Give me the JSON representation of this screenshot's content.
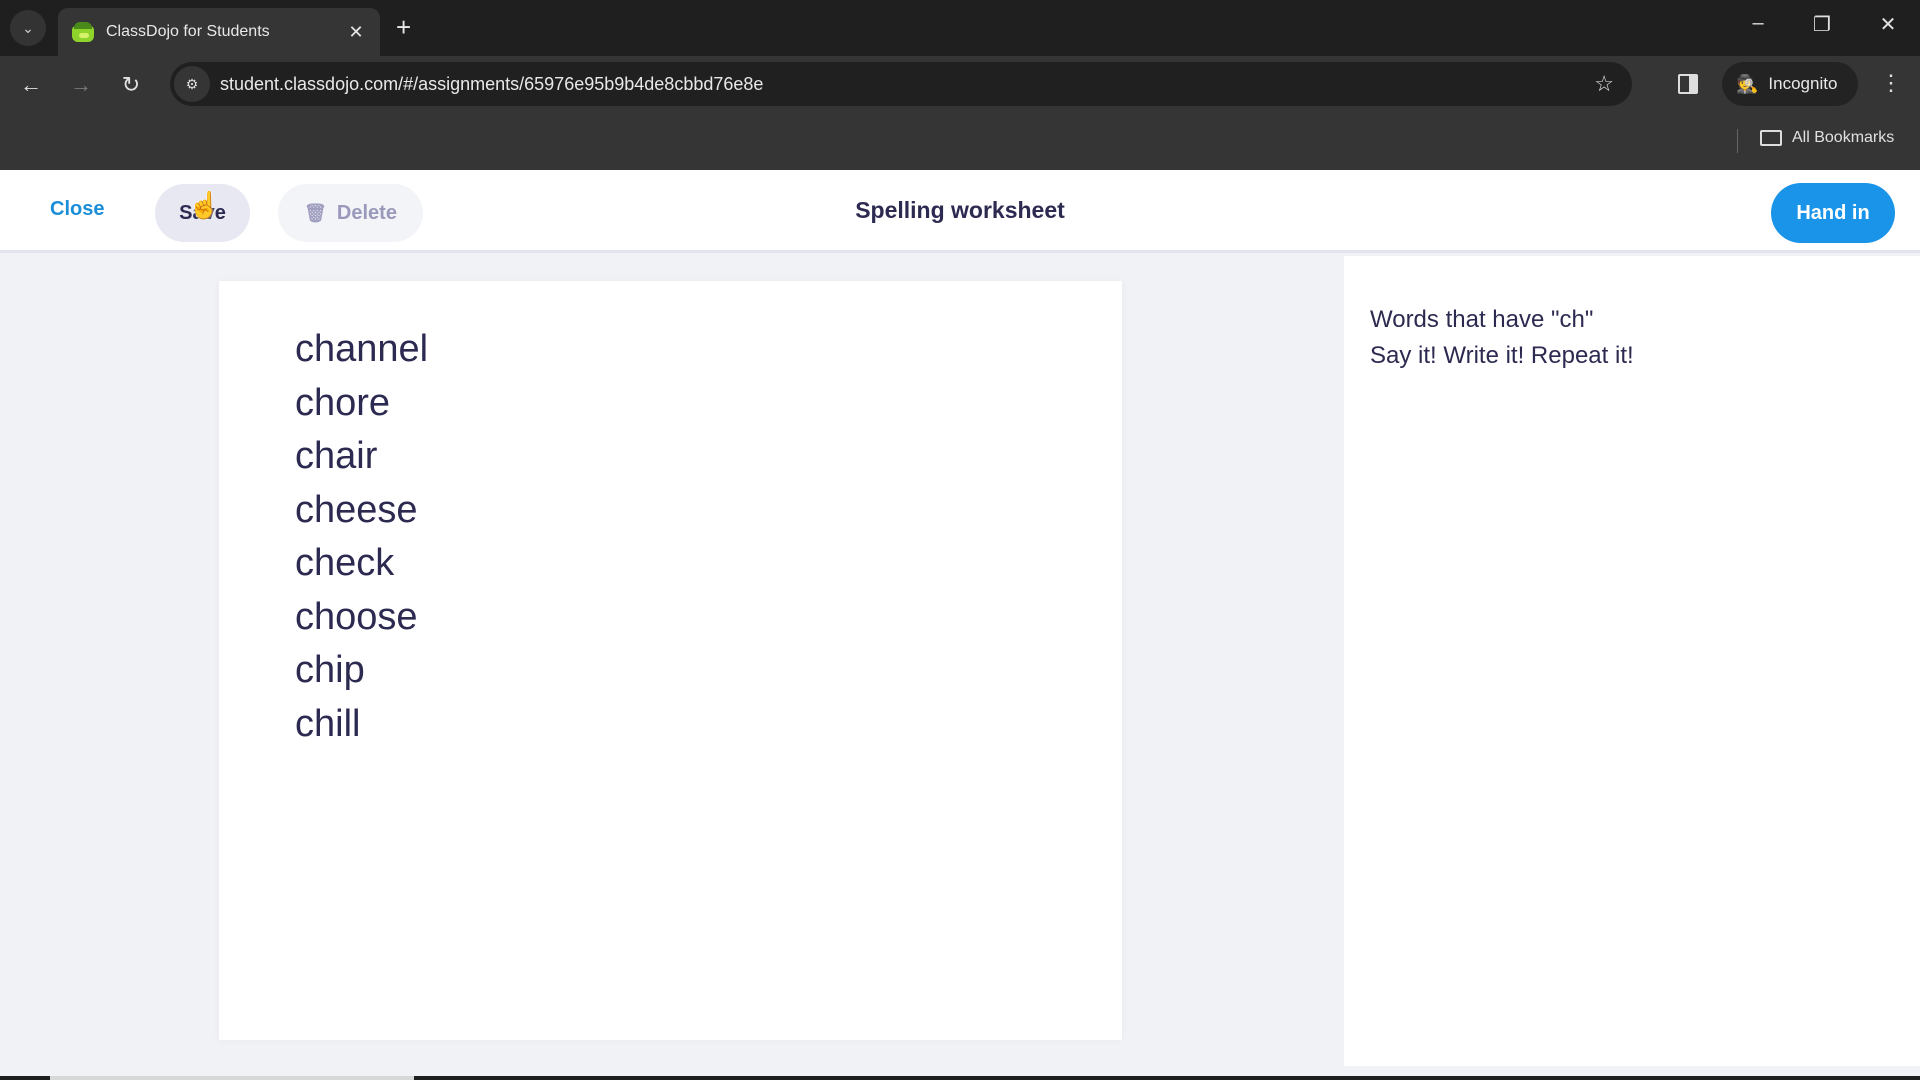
{
  "browser": {
    "tab_title": "ClassDojo for Students",
    "url": "student.classdojo.com/#/assignments/65976e95b9b4de8cbbd76e8e",
    "incognito_label": "Incognito",
    "bookmarks_label": "All Bookmarks",
    "icons": {
      "tab_search": "chevron-down-icon",
      "tab_close": "✕",
      "new_tab": "+",
      "minimize": "–",
      "restore": "❐",
      "close": "✕",
      "back": "←",
      "forward": "→",
      "reload": "↻",
      "site_info": "⚙",
      "star": "☆",
      "incognito": "🕵",
      "menu": "⋮"
    }
  },
  "header": {
    "close_label": "Close",
    "save_label": "Save",
    "delete_label": "Delete",
    "title": "Spelling worksheet",
    "handin_label": "Hand in",
    "accent_color": "#1a94e8"
  },
  "worksheet": {
    "words": [
      "channel",
      "chore",
      "chair",
      "cheese",
      "check",
      "choose",
      "chip",
      "chill"
    ]
  },
  "instructions": {
    "lines": [
      "Words that have \"ch\"",
      "Say it! Write it! Repeat it!"
    ]
  }
}
